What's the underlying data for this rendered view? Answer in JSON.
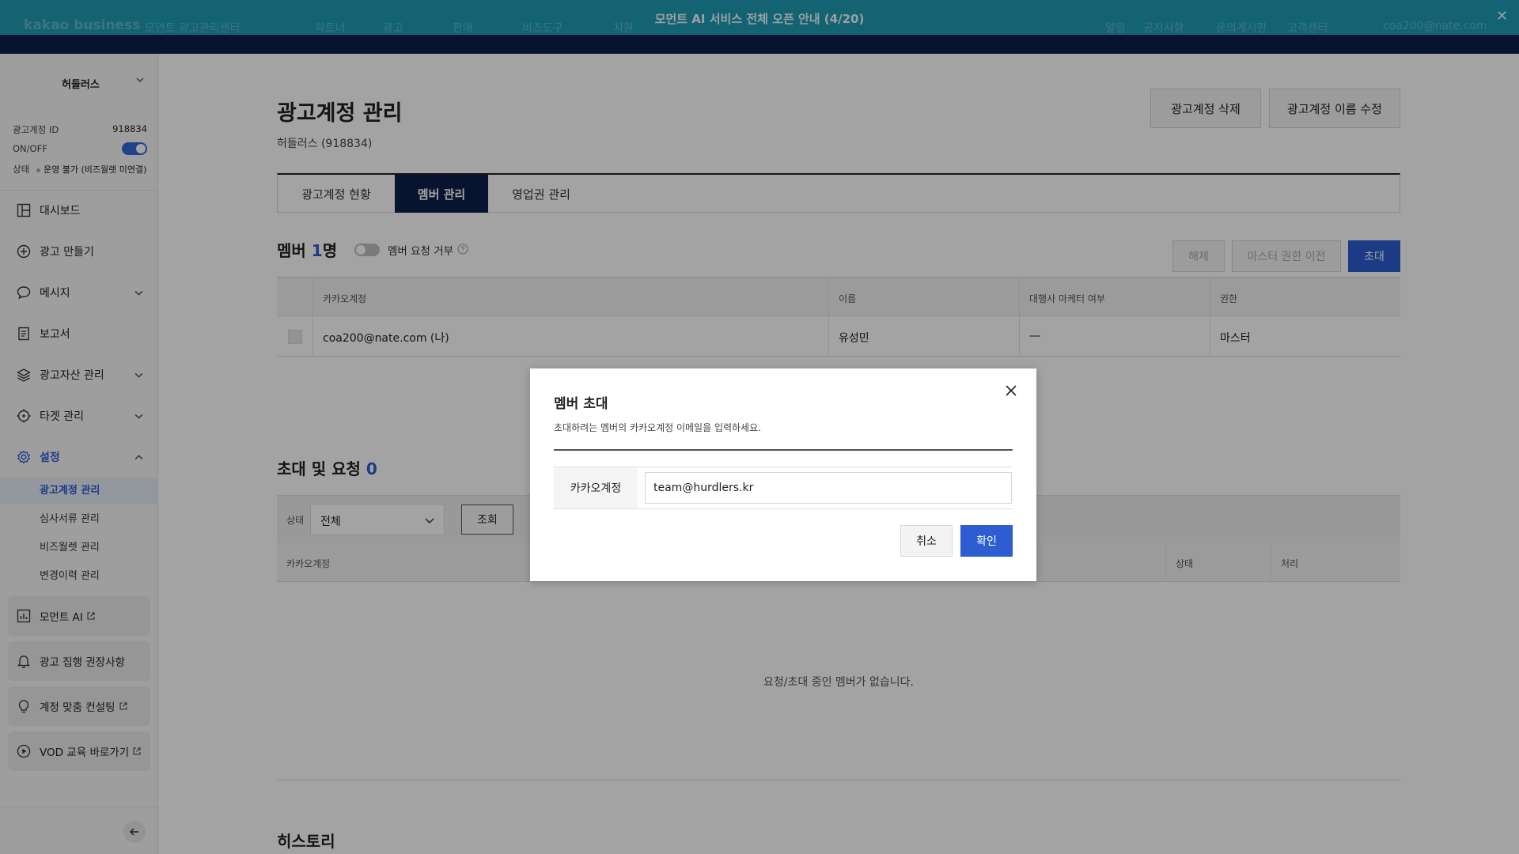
{
  "banner": {
    "text": "모먼트 AI 서비스 전체 오픈 안내 (4/20)",
    "brand": "kakao business",
    "brand_sub": "모먼트 광고관리센터",
    "nav": [
      "파트너",
      "광고",
      "판매",
      "비즈도구",
      "지원"
    ],
    "util": [
      "알림",
      "공지사항",
      "문의게시판",
      "고객센터"
    ],
    "user": "coa200@nate.com"
  },
  "sidebar": {
    "account_name": "허들러스",
    "meta": {
      "id_label": "광고계정 ID",
      "id_value": "918834",
      "onoff_label": "ON/OFF",
      "status_label": "상태",
      "status_value": "운영 불가 (비즈월렛 미연결)"
    },
    "items": [
      {
        "label": "대시보드",
        "icon": "dashboard-icon"
      },
      {
        "label": "광고 만들기",
        "icon": "plus-circle-icon"
      },
      {
        "label": "메시지",
        "icon": "chat-bubble-icon"
      },
      {
        "label": "보고서",
        "icon": "report-icon"
      },
      {
        "label": "광고자산 관리",
        "icon": "layers-icon"
      },
      {
        "label": "타겟 관리",
        "icon": "target-icon"
      },
      {
        "label": "설정",
        "icon": "gear-icon"
      }
    ],
    "sub_items": [
      "광고계정 관리",
      "심사서류 관리",
      "비즈월렛 관리",
      "변경이력 관리"
    ],
    "cards": [
      {
        "label": "모먼트 AI",
        "icon": "chart-icon"
      },
      {
        "label": "광고 집행 권장사항",
        "icon": "bell-icon"
      },
      {
        "label": "계정 맞춤 컨설팅",
        "icon": "lightbulb-icon"
      },
      {
        "label": "VOD 교육 바로가기",
        "icon": "play-icon"
      }
    ]
  },
  "main": {
    "title": "광고계정 관리",
    "subtitle": "허들러스 (918834)",
    "delete_btn": "광고계정 삭제",
    "rename_btn": "광고계정 이름 수정",
    "tabs": [
      "광고계정 현황",
      "멤버 관리",
      "영업권 관리"
    ],
    "members": {
      "heading": "멤버",
      "count": "1",
      "unit": "명",
      "toggle_label": "멤버 요청 거부",
      "buttons": {
        "release": "해제",
        "transfer": "마스터 권한 이전",
        "invite": "초대"
      },
      "columns": [
        "카카오계정",
        "이름",
        "대행사 마케터 여부",
        "권한"
      ],
      "rows": [
        {
          "account": "coa200@nate.com (나)",
          "name": "유성민",
          "agency": "—",
          "role": "마스터"
        }
      ]
    },
    "invites": {
      "heading": "초대 및 요청",
      "count": "0",
      "filter_label": "상태",
      "filter_value": "전체",
      "search_btn": "조회",
      "columns": [
        "카카오계정",
        "상태",
        "처리"
      ],
      "empty": "요청/초대 중인 멤버가 없습니다."
    },
    "history_heading": "히스토리"
  },
  "modal": {
    "title": "멤버 초대",
    "desc": "초대하려는 멤버의 카카오계정 이메일을 입력하세요.",
    "field_label": "카카오계정",
    "field_value": "team@hurdlers.kr",
    "cancel": "취소",
    "confirm": "확인"
  },
  "colors": {
    "banner": "#1e9bb5",
    "navy": "#0e1f4c",
    "primary": "#2d5dd1"
  }
}
